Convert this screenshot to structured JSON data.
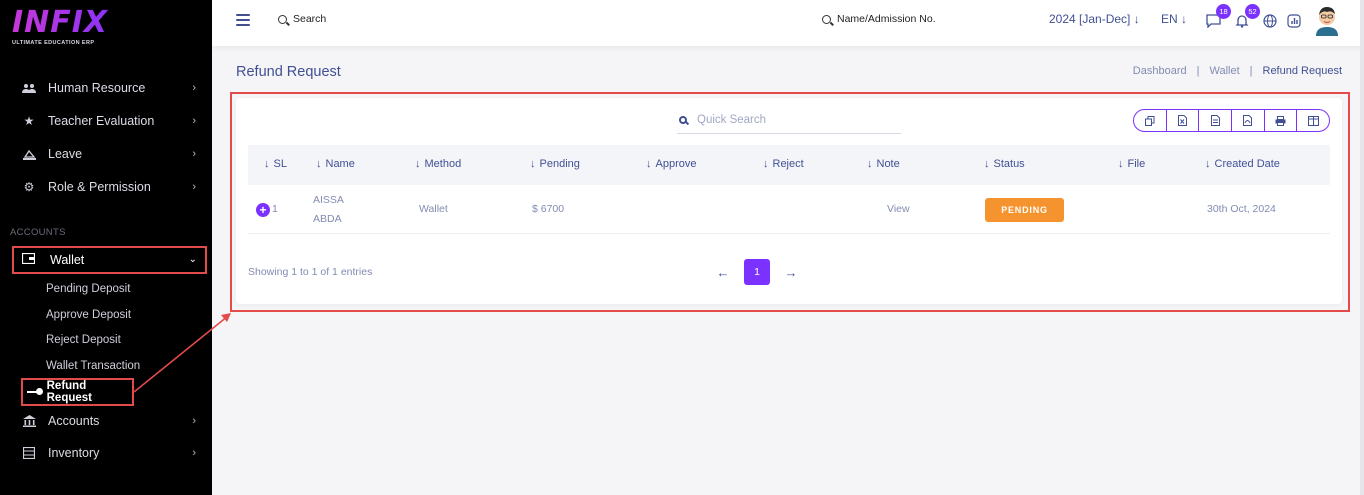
{
  "brand": {
    "name": "INFIX",
    "tagline": "ULTIMATE EDUCATION ERP"
  },
  "sidebar": {
    "items": [
      {
        "label": "Human Resource",
        "icon": "users-icon"
      },
      {
        "label": "Teacher Evaluation",
        "icon": "star-icon"
      },
      {
        "label": "Leave",
        "icon": "leave-icon"
      },
      {
        "label": "Role & Permission",
        "icon": "settings-icon"
      }
    ],
    "section": "ACCOUNTS",
    "wallet": {
      "label": "Wallet",
      "icon": "wallet-icon"
    },
    "wallet_sub": [
      "Pending Deposit",
      "Approve Deposit",
      "Reject Deposit",
      "Wallet Transaction",
      "Refund Request"
    ],
    "bottom_items": [
      {
        "label": "Accounts",
        "icon": "bank-icon"
      },
      {
        "label": "Inventory",
        "icon": "inventory-icon"
      }
    ]
  },
  "topbar": {
    "search": "Search",
    "search2": "Name/Admission No.",
    "year": "2024 [Jan-Dec]",
    "lang": "EN",
    "messages_count": "18",
    "notifications_count": "52"
  },
  "page": {
    "title": "Refund Request",
    "breadcrumb": [
      "Dashboard",
      "Wallet",
      "Refund Request"
    ],
    "separator": "|"
  },
  "table": {
    "quick_search_placeholder": "Quick Search",
    "export_buttons": [
      "copy-icon",
      "excel-icon",
      "csv-icon",
      "pdf-icon",
      "print-icon",
      "columns-icon"
    ],
    "columns": [
      "SL",
      "Name",
      "Method",
      "Pending",
      "Approve",
      "Reject",
      "Note",
      "Status",
      "File",
      "Created Date"
    ],
    "rows": [
      {
        "sl": "1",
        "name_line1": "AISSA",
        "name_line2": "ABDA",
        "method": "Wallet",
        "pending": "$ 6700",
        "approve": "",
        "reject": "",
        "note": "View",
        "status": "PENDING",
        "file": "",
        "created": "30th Oct, 2024"
      }
    ],
    "info": "Showing 1 to 1 of 1 entries",
    "current_page": "1"
  },
  "colors": {
    "accent": "#7c32ff",
    "text": "#415094",
    "muted": "#828bb2",
    "pending": "#f5932e",
    "highlight": "#e34a4a",
    "sidebar_bg": "#000000"
  }
}
